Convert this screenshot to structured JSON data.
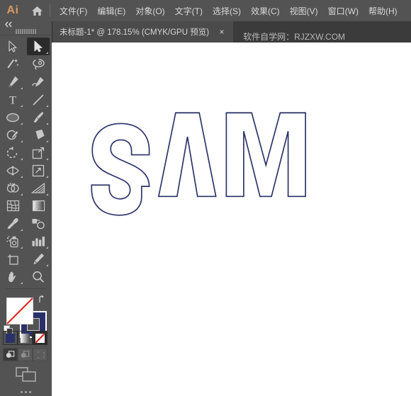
{
  "app": {
    "logo_text": "Ai",
    "home_icon": "home-icon"
  },
  "menubar": {
    "items": [
      {
        "label": "文件(F)",
        "name": "menu-file"
      },
      {
        "label": "编辑(E)",
        "name": "menu-edit"
      },
      {
        "label": "对象(O)",
        "name": "menu-object"
      },
      {
        "label": "文字(T)",
        "name": "menu-type"
      },
      {
        "label": "选择(S)",
        "name": "menu-select"
      },
      {
        "label": "效果(C)",
        "name": "menu-effect"
      },
      {
        "label": "视图(V)",
        "name": "menu-view"
      },
      {
        "label": "窗口(W)",
        "name": "menu-window"
      },
      {
        "label": "帮助(H)",
        "name": "menu-help"
      }
    ]
  },
  "tabbar": {
    "document_tab": {
      "label": "未标题-1* @ 178.15% (CMYK/GPU 预览)",
      "close_label": "×",
      "document_name": "未标题-1*",
      "zoom_level": "178.15%",
      "color_mode": "CMYK",
      "preview_mode": "GPU 预览",
      "modified": true
    },
    "watermark": "软件自学网：RJZXW.COM"
  },
  "toolbar": {
    "collapse_label": "◂◂",
    "rows": [
      [
        {
          "name": "direct-selection-tool-icon",
          "icon": "direct-selection",
          "active": false,
          "has_flyout": false
        },
        {
          "name": "selection-tool-icon",
          "icon": "selection",
          "active": true,
          "has_flyout": true
        }
      ],
      [
        {
          "name": "magic-wand-tool-icon",
          "icon": "magic-wand",
          "active": false,
          "has_flyout": false
        },
        {
          "name": "lasso-tool-icon",
          "icon": "lasso",
          "active": false,
          "has_flyout": false
        }
      ],
      [
        {
          "name": "pen-tool-icon",
          "icon": "pen",
          "active": false,
          "has_flyout": true
        },
        {
          "name": "curvature-tool-icon",
          "icon": "curvature",
          "active": false,
          "has_flyout": false
        }
      ],
      [
        {
          "name": "type-tool-icon",
          "icon": "type",
          "active": false,
          "has_flyout": true
        },
        {
          "name": "line-segment-tool-icon",
          "icon": "line-segment",
          "active": false,
          "has_flyout": true
        }
      ],
      [
        {
          "name": "ellipse-tool-icon",
          "icon": "ellipse",
          "active": false,
          "has_flyout": true
        },
        {
          "name": "paintbrush-tool-icon",
          "icon": "paintbrush",
          "active": false,
          "has_flyout": true
        }
      ],
      [
        {
          "name": "shaper-tool-icon",
          "icon": "shaper",
          "active": false,
          "has_flyout": true
        },
        {
          "name": "eraser-tool-icon",
          "icon": "eraser",
          "active": false,
          "has_flyout": true
        }
      ],
      [
        {
          "name": "rotate-tool-icon",
          "icon": "rotate",
          "active": false,
          "has_flyout": true
        },
        {
          "name": "scale-tool-icon",
          "icon": "scale",
          "active": false,
          "has_flyout": true
        }
      ],
      [
        {
          "name": "width-tool-icon",
          "icon": "width",
          "active": false,
          "has_flyout": true
        },
        {
          "name": "free-transform-tool-icon",
          "icon": "free-transform",
          "active": false,
          "has_flyout": true
        }
      ],
      [
        {
          "name": "shape-builder-tool-icon",
          "icon": "shape-builder",
          "active": false,
          "has_flyout": true
        },
        {
          "name": "perspective-grid-tool-icon",
          "icon": "perspective-grid",
          "active": false,
          "has_flyout": true
        }
      ],
      [
        {
          "name": "mesh-tool-icon",
          "icon": "mesh",
          "active": false,
          "has_flyout": false
        },
        {
          "name": "gradient-tool-icon",
          "icon": "gradient",
          "active": false,
          "has_flyout": false
        }
      ],
      [
        {
          "name": "eyedropper-tool-icon",
          "icon": "eyedropper",
          "active": false,
          "has_flyout": true
        },
        {
          "name": "blend-tool-icon",
          "icon": "blend",
          "active": false,
          "has_flyout": false
        }
      ],
      [
        {
          "name": "symbol-sprayer-tool-icon",
          "icon": "symbol-sprayer",
          "active": false,
          "has_flyout": true
        },
        {
          "name": "column-graph-tool-icon",
          "icon": "column-graph",
          "active": false,
          "has_flyout": true
        }
      ],
      [
        {
          "name": "artboard-tool-icon",
          "icon": "artboard",
          "active": false,
          "has_flyout": false
        },
        {
          "name": "slice-tool-icon",
          "icon": "slice",
          "active": false,
          "has_flyout": true
        }
      ],
      [
        {
          "name": "hand-tool-icon",
          "icon": "hand",
          "active": false,
          "has_flyout": true
        },
        {
          "name": "zoom-tool-icon",
          "icon": "zoom",
          "active": false,
          "has_flyout": false
        }
      ]
    ],
    "fill_stroke": {
      "fill_value": "none",
      "fill_color": "#ffffff",
      "stroke_color": "#2a3169",
      "swap_icon": "swap-fill-stroke-icon",
      "default_icon": "default-fill-stroke-icon"
    },
    "color_modes": [
      {
        "name": "color-button",
        "label": "color",
        "active": false
      },
      {
        "name": "gradient-button",
        "label": "gradient",
        "active": false
      },
      {
        "name": "none-button",
        "label": "none",
        "active": true
      }
    ],
    "draw_modes": [
      {
        "name": "draw-normal-button",
        "label": "draw-normal",
        "active": true
      },
      {
        "name": "draw-behind-button",
        "label": "draw-behind",
        "active": false
      },
      {
        "name": "draw-inside-button",
        "label": "draw-inside",
        "active": false
      }
    ],
    "screen_mode": {
      "name": "change-screen-mode-button",
      "label": "screen-mode"
    },
    "more_tools": {
      "name": "edit-toolbar-button",
      "label": "•••"
    }
  },
  "canvas": {
    "artwork": {
      "text": "SAM",
      "fill": "none",
      "stroke_color": "#2a3169",
      "stroke_width": 1.5,
      "letters": [
        "S",
        "A",
        "M"
      ]
    },
    "background_color": "#ffffff"
  },
  "colors": {
    "menubar_bg": "#535353",
    "tabbar_bg": "#3b3b3b",
    "active_tab_bg": "#4b4b4b",
    "toolbar_bg": "#535353",
    "canvas_bg": "#ffffff",
    "accent_orange": "#dd9a63",
    "stroke_navy": "#2a3169"
  }
}
